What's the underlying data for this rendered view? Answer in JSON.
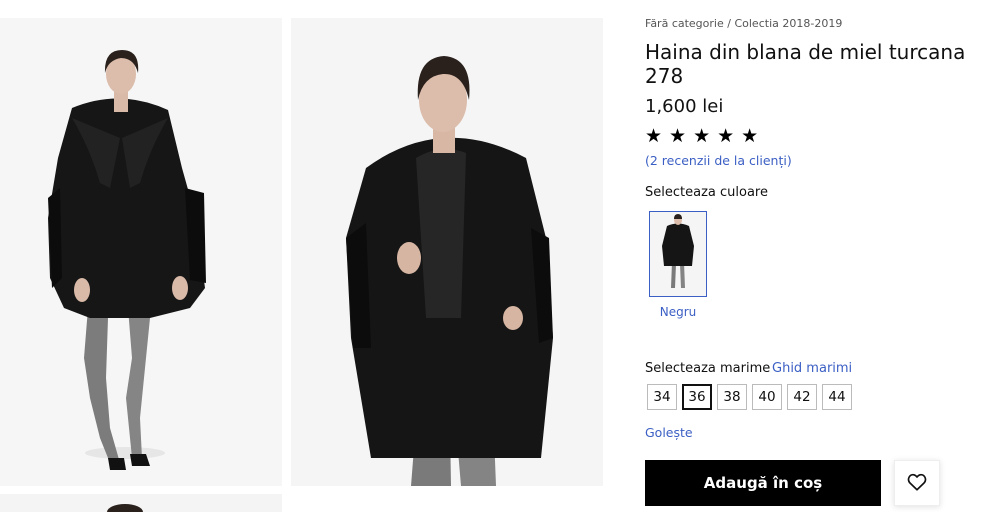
{
  "breadcrumb": {
    "category": "Fără categorie",
    "separator": "/",
    "collection": "Colectia 2018-2019"
  },
  "product": {
    "title": "Haina din blana de miel turcana 278",
    "price": "1,600 lei",
    "rating_stars": "★★★★★",
    "rating_value": 5,
    "reviews_link": "(2 recenzii de la clienți)"
  },
  "color": {
    "label": "Selecteaza culoare",
    "options": [
      {
        "name": "Negru",
        "selected": true
      }
    ]
  },
  "size": {
    "label": "Selecteaza marime",
    "guide_link": "Ghid marimi",
    "options": [
      "34",
      "36",
      "38",
      "40",
      "42",
      "44"
    ],
    "selected": "36",
    "clear_label": "Golește"
  },
  "actions": {
    "add_to_cart": "Adaugă în coș",
    "wishlist_icon": "heart-icon"
  },
  "colors": {
    "accent": "#3b5fc4",
    "button_bg": "#000000",
    "coat": "#141414"
  }
}
